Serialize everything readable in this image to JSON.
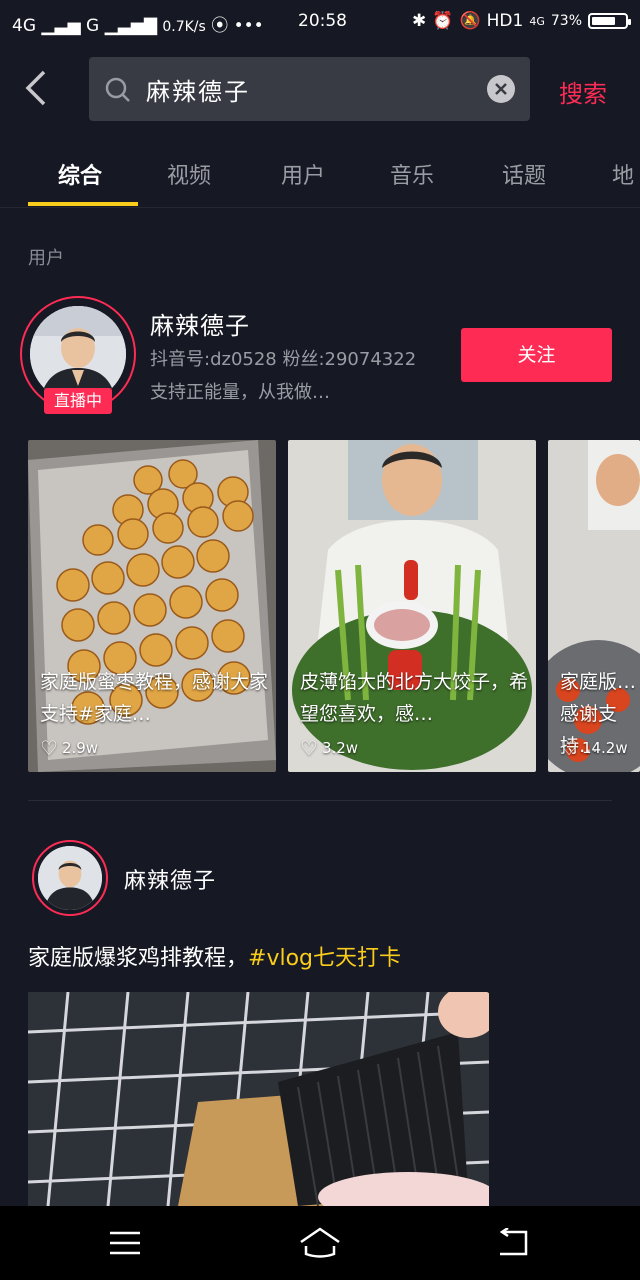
{
  "status_bar": {
    "network_left": "4G",
    "network_right": "G",
    "speed": "0.7K/s",
    "time": "20:58",
    "hd": "HD1",
    "battery_text": "73%",
    "battery_level": 0.73
  },
  "search": {
    "query": "麻辣德子",
    "submit_label": "搜索"
  },
  "tabs": [
    {
      "label": "综合",
      "active": true
    },
    {
      "label": "视频",
      "active": false
    },
    {
      "label": "用户",
      "active": false
    },
    {
      "label": "音乐",
      "active": false
    },
    {
      "label": "话题",
      "active": false
    },
    {
      "label": "地",
      "active": false
    }
  ],
  "section_label": "用户",
  "user_card": {
    "name": "麻辣德子",
    "meta": "抖音号:dz0528 粉丝:29074322",
    "bio": "支持正能量，从我做…",
    "live_badge": "直播中",
    "follow_label": "关注"
  },
  "videos": [
    {
      "caption": "家庭版蜜枣教程，感谢大家支持#家庭…",
      "likes": "2.9w"
    },
    {
      "caption": "皮薄馅大的北方大饺子，希望您喜欢，感…",
      "likes": "3.2w"
    },
    {
      "caption": "家庭版…感谢支持…",
      "likes": "14.2w"
    }
  ],
  "post": {
    "author": "麻辣德子",
    "caption_text": "家庭版爆浆鸡排教程，",
    "caption_tag": "#vlog七天打卡"
  },
  "colors": {
    "accent": "#fe2c55",
    "tab_indicator": "#facc1c",
    "background": "#161823"
  }
}
